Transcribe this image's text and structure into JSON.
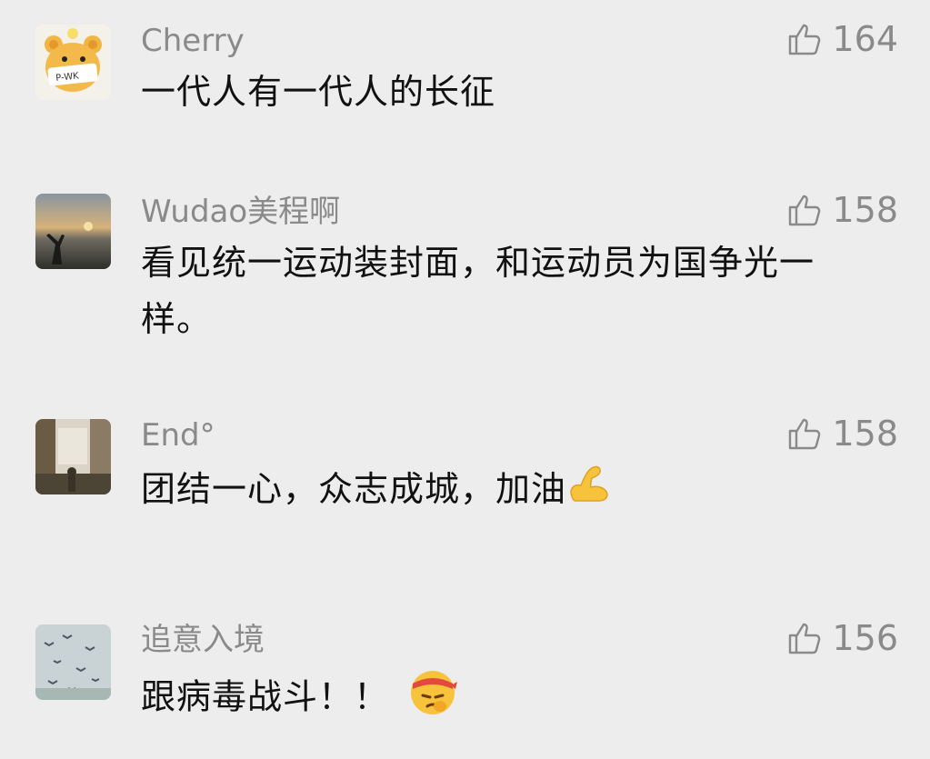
{
  "comments": [
    {
      "name": "Cherry",
      "likes": "164",
      "text": "一代人有一代人的长征",
      "avatar": "bear-avatar"
    },
    {
      "name": "Wudao美程啊",
      "likes": "158",
      "text": "看见统一运动装封面，和运动员为国争光一样。",
      "avatar": "sunset-photo-avatar"
    },
    {
      "name": "End°",
      "likes": "158",
      "text": "团结一心，众志成城，加油",
      "emoji": "flexed-biceps",
      "avatar": "street-photo-avatar"
    },
    {
      "name": "追意入境",
      "likes": "156",
      "text": "跟病毒战斗！！",
      "emoji": "determined-face-headband",
      "avatar": "birds-sky-avatar"
    }
  ],
  "colors": {
    "background": "#ededed",
    "name": "#8a8a8a",
    "text": "#111111"
  }
}
